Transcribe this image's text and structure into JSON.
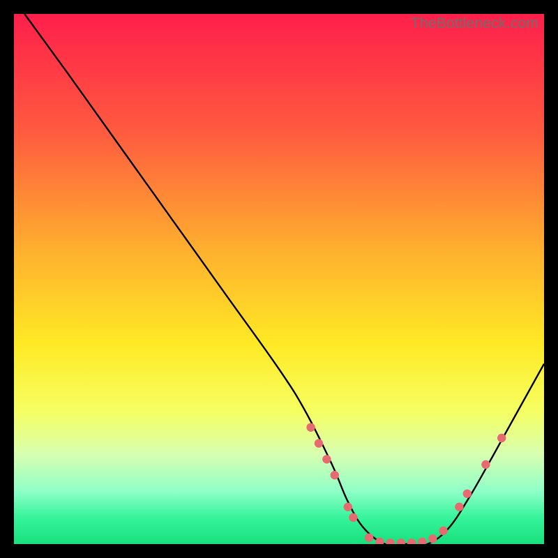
{
  "watermark": "TheBottleneck.com",
  "colors": {
    "dot": "#e66a6f",
    "curve": "#000000"
  },
  "chart_data": {
    "type": "line",
    "title": "",
    "xlabel": "",
    "ylabel": "",
    "xlim": [
      0,
      100
    ],
    "ylim": [
      0,
      100
    ],
    "grid": false,
    "legend": false,
    "background_gradient_stops": [
      {
        "pct": 0,
        "color": "#ff1f4b"
      },
      {
        "pct": 22,
        "color": "#ff5a3f"
      },
      {
        "pct": 45,
        "color": "#ffb12e"
      },
      {
        "pct": 62,
        "color": "#ffe924"
      },
      {
        "pct": 75,
        "color": "#f6ff62"
      },
      {
        "pct": 83,
        "color": "#d8ffb0"
      },
      {
        "pct": 90,
        "color": "#8fffc8"
      },
      {
        "pct": 95,
        "color": "#36f49a"
      },
      {
        "pct": 100,
        "color": "#18e07e"
      }
    ],
    "series": [
      {
        "name": "bottleneck-curve",
        "x": [
          2,
          10,
          20,
          30,
          40,
          50,
          55,
          60,
          63,
          66,
          70,
          74,
          78,
          82,
          86,
          90,
          95,
          100
        ],
        "y": [
          100,
          89,
          75,
          61,
          47,
          33,
          25,
          15,
          8,
          3,
          0,
          0,
          0,
          3,
          9,
          16,
          25,
          34
        ]
      }
    ],
    "markers": {
      "name": "highlight-dots",
      "points": [
        {
          "x": 56,
          "y": 22
        },
        {
          "x": 57.5,
          "y": 19
        },
        {
          "x": 59,
          "y": 16
        },
        {
          "x": 60.5,
          "y": 13
        },
        {
          "x": 63,
          "y": 7
        },
        {
          "x": 64,
          "y": 5
        },
        {
          "x": 67,
          "y": 1.2
        },
        {
          "x": 69,
          "y": 0.4
        },
        {
          "x": 71,
          "y": 0.2
        },
        {
          "x": 73,
          "y": 0.2
        },
        {
          "x": 75,
          "y": 0.2
        },
        {
          "x": 77,
          "y": 0.4
        },
        {
          "x": 79,
          "y": 1.0
        },
        {
          "x": 81,
          "y": 2.5
        },
        {
          "x": 84,
          "y": 7
        },
        {
          "x": 85.5,
          "y": 9.5
        },
        {
          "x": 89,
          "y": 15
        },
        {
          "x": 92,
          "y": 20
        }
      ]
    }
  }
}
